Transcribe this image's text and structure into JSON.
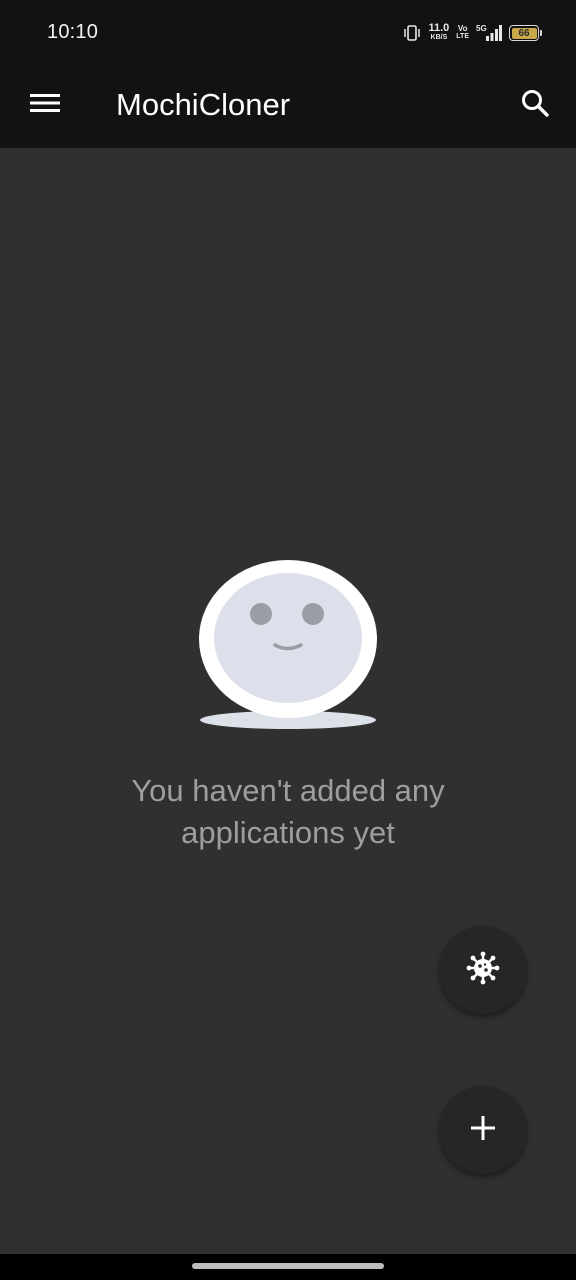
{
  "status_bar": {
    "time": "10:10",
    "net_speed_value": "11.0",
    "net_speed_unit": "KB/S",
    "volte_top": "Vo",
    "volte_bottom": "LTE",
    "network_type": "5G",
    "battery_level": "66",
    "battery_color": "#c9a94a"
  },
  "app_bar": {
    "title": "MochiCloner",
    "menu_icon": "hamburger-menu-icon",
    "search_icon": "search-icon"
  },
  "empty_state": {
    "illustration": "smiling-mochi-face",
    "message_line1": "You haven't added any",
    "message_line2": "applications yet"
  },
  "fabs": {
    "virus_icon": "virus-icon",
    "add_icon": "plus-icon"
  },
  "colors": {
    "app_bar_bg": "#121212",
    "content_bg": "#303030",
    "fab_bg": "#262626",
    "message_text": "#9e9e9e"
  }
}
